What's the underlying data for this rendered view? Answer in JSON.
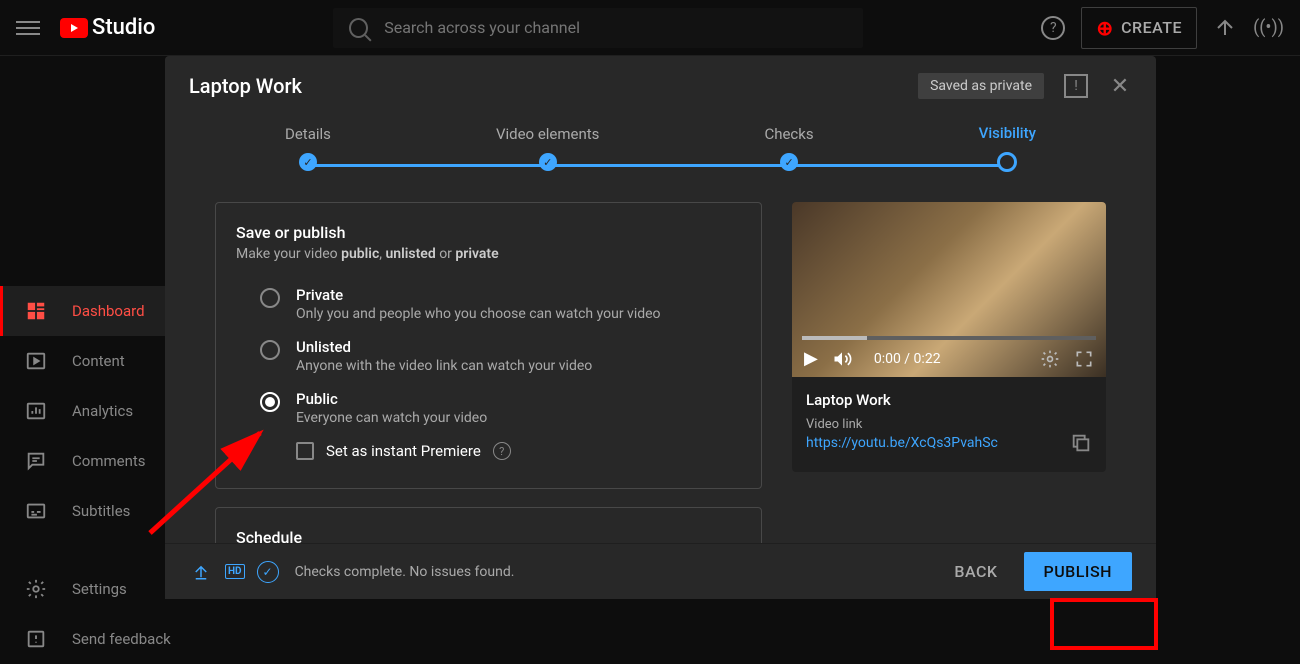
{
  "header": {
    "logo_text": "Studio",
    "search_placeholder": "Search across your channel",
    "create_label": "CREATE"
  },
  "sidebar": {
    "items": [
      {
        "label": "Dashboard"
      },
      {
        "label": "Content"
      },
      {
        "label": "Analytics"
      },
      {
        "label": "Comments"
      },
      {
        "label": "Subtitles"
      },
      {
        "label": "Settings"
      },
      {
        "label": "Send feedback"
      }
    ]
  },
  "modal": {
    "title": "Laptop Work",
    "saved_badge": "Saved as private",
    "steps": [
      {
        "label": "Details"
      },
      {
        "label": "Video elements"
      },
      {
        "label": "Checks"
      },
      {
        "label": "Visibility"
      }
    ],
    "save_title": "Save or publish",
    "save_sub_pre": "Make your video ",
    "save_sub_b1": "public",
    "save_sub_mid": ", ",
    "save_sub_b2": "unlisted",
    "save_sub_mid2": " or ",
    "save_sub_b3": "private",
    "opts": [
      {
        "title": "Private",
        "desc": "Only you and people who you choose can watch your video"
      },
      {
        "title": "Unlisted",
        "desc": "Anyone with the video link can watch your video"
      },
      {
        "title": "Public",
        "desc": "Everyone can watch your video"
      }
    ],
    "premiere_label": "Set as instant Premiere",
    "schedule_title": "Schedule",
    "preview": {
      "time": "0:00 / 0:22",
      "title": "Laptop Work",
      "link_label": "Video link",
      "link": "https://youtu.be/XcQs3PvahSc"
    },
    "footer": {
      "status": "Checks complete. No issues found.",
      "back": "BACK",
      "publish": "PUBLISH",
      "hd": "HD"
    }
  }
}
